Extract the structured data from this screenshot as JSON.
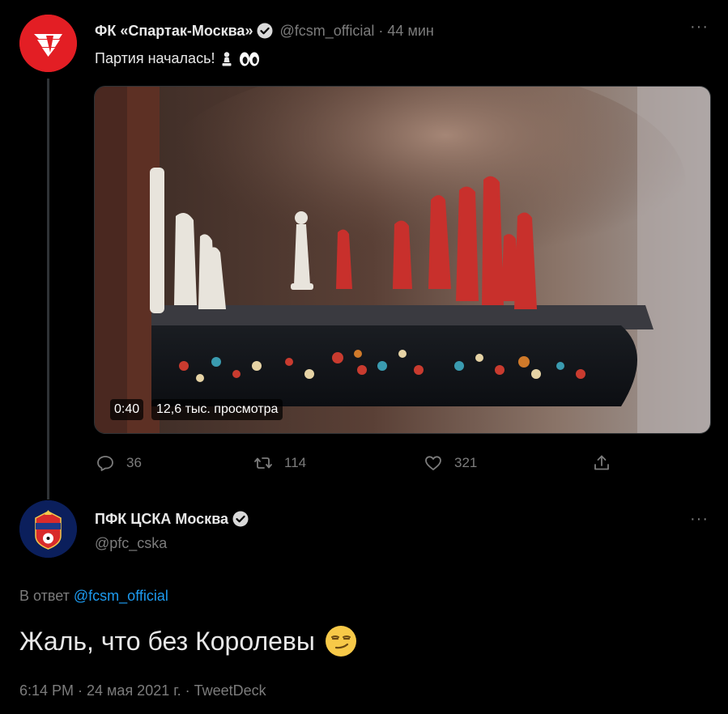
{
  "tweet1": {
    "display_name": "ФК «Спартак-Москва»",
    "handle_time": "@fcsm_official · 44 мин",
    "more": "···",
    "text": "Партия началась!",
    "video": {
      "duration": "0:40",
      "views": "12,6 тыс. просмотра"
    },
    "actions": {
      "replies": "36",
      "retweets": "114",
      "likes": "321"
    }
  },
  "tweet2": {
    "display_name": "ПФК ЦСКА Москва",
    "handle": "@pfc_cska",
    "more": "···",
    "reply_prefix": "В ответ",
    "reply_handle": "@fcsm_official",
    "text": "Жаль, что без Королевы",
    "meta": "6:14 PM · 24 мая 2021 г. · TweetDeck"
  },
  "icons": [
    "verified-icon",
    "pawn-emoji-icon",
    "eyes-emoji-icon",
    "reply-icon",
    "retweet-icon",
    "like-icon",
    "share-icon",
    "smirk-emoji-icon"
  ],
  "colors": {
    "background": "#000000",
    "link": "#1d9bf0",
    "muted": "#7c7c7c",
    "spartak_red": "#e31e24",
    "cska_blue": "#0b1f5c"
  }
}
